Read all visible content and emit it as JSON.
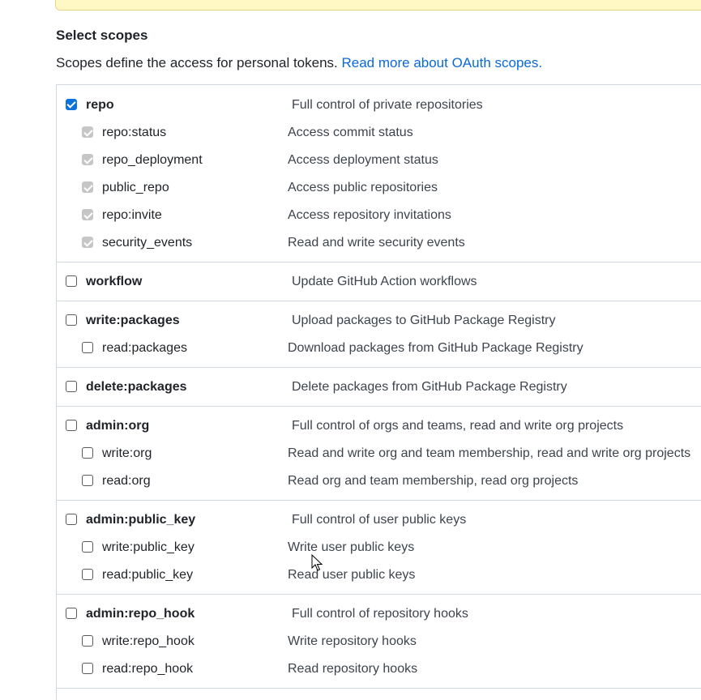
{
  "section": {
    "heading": "Select scopes",
    "description": "Scopes define the access for personal tokens.",
    "link_text": "Read more about OAuth scopes."
  },
  "scopes": [
    {
      "name": "repo",
      "description": "Full control of private repositories",
      "checked": true,
      "children": [
        {
          "name": "repo:status",
          "description": "Access commit status",
          "checked": true,
          "disabled": true
        },
        {
          "name": "repo_deployment",
          "description": "Access deployment status",
          "checked": true,
          "disabled": true
        },
        {
          "name": "public_repo",
          "description": "Access public repositories",
          "checked": true,
          "disabled": true
        },
        {
          "name": "repo:invite",
          "description": "Access repository invitations",
          "checked": true,
          "disabled": true
        },
        {
          "name": "security_events",
          "description": "Read and write security events",
          "checked": true,
          "disabled": true
        }
      ]
    },
    {
      "name": "workflow",
      "description": "Update GitHub Action workflows",
      "checked": false,
      "children": []
    },
    {
      "name": "write:packages",
      "description": "Upload packages to GitHub Package Registry",
      "checked": false,
      "children": [
        {
          "name": "read:packages",
          "description": "Download packages from GitHub Package Registry",
          "checked": false
        }
      ]
    },
    {
      "name": "delete:packages",
      "description": "Delete packages from GitHub Package Registry",
      "checked": false,
      "children": []
    },
    {
      "name": "admin:org",
      "description": "Full control of orgs and teams, read and write org projects",
      "checked": false,
      "children": [
        {
          "name": "write:org",
          "description": "Read and write org and team membership, read and write org projects",
          "checked": false
        },
        {
          "name": "read:org",
          "description": "Read org and team membership, read org projects",
          "checked": false
        }
      ]
    },
    {
      "name": "admin:public_key",
      "description": "Full control of user public keys",
      "checked": false,
      "children": [
        {
          "name": "write:public_key",
          "description": "Write user public keys",
          "checked": false
        },
        {
          "name": "read:public_key",
          "description": "Read user public keys",
          "checked": false
        }
      ]
    },
    {
      "name": "admin:repo_hook",
      "description": "Full control of repository hooks",
      "checked": false,
      "children": [
        {
          "name": "write:repo_hook",
          "description": "Write repository hooks",
          "checked": false
        },
        {
          "name": "read:repo_hook",
          "description": "Read repository hooks",
          "checked": false
        }
      ]
    }
  ],
  "colors": {
    "accent": "#0969da",
    "checkbox_checked": "#0a72d8",
    "checkbox_disabled": "#c6c6c6",
    "border": "#d0d7de",
    "flash": "#fff8c5"
  }
}
